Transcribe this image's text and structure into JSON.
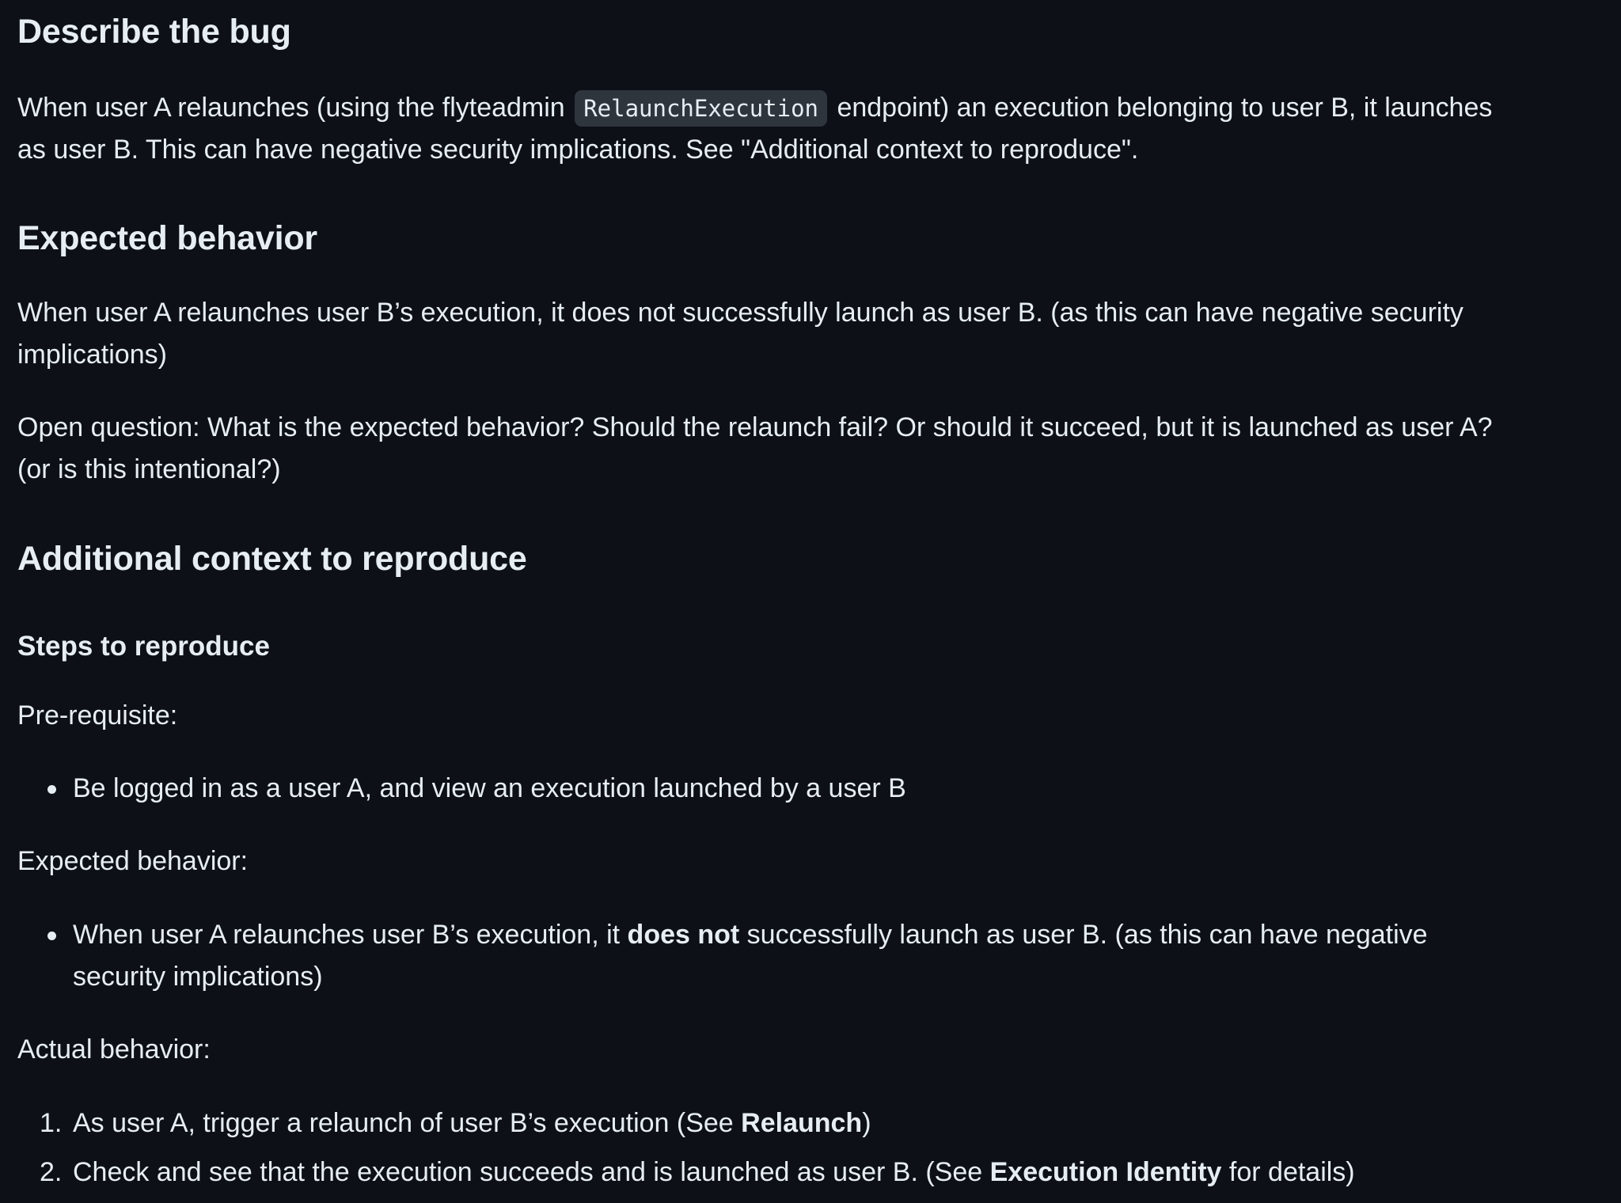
{
  "describe_bug": {
    "heading": "Describe the bug",
    "p1_a": "When user A relaunches (using the flyteadmin",
    "p1_code": "RelaunchExecution",
    "p1_b": "endpoint) an execution belonging to user B, it launches",
    "p1_line2": "as user B. This can have negative security implications. See \"Additional context to reproduce\"."
  },
  "expected_behavior": {
    "heading": "Expected behavior",
    "p1_line1": "When user A relaunches user B’s execution, it does not successfully launch as user B. (as this can have negative security",
    "p1_line2": "implications)",
    "p2_line1": "Open question: What is the expected behavior? Should the relaunch fail? Or should it succeed, but it is launched as user A?",
    "p2_line2": "(or is this intentional?)"
  },
  "additional_context": {
    "heading": "Additional context to reproduce",
    "steps_heading": "Steps to reproduce",
    "prereq_label": "Pre-requisite:",
    "prereq_item": "Be logged in as a user A, and view an execution launched by a user B",
    "expected_label": "Expected behavior:",
    "expected_item_a": "When user A relaunches user B’s execution, it",
    "expected_item_bold": "does not",
    "expected_item_b": "successfully launch as user B. (as this can have negative",
    "expected_item_line2": "security implications)",
    "actual_label": "Actual behavior:",
    "actual_steps": [
      {
        "num": "1.",
        "text_a": "As user A, trigger a relaunch of user B’s execution (See",
        "bold": "Relaunch",
        "text_b": ")"
      },
      {
        "num": "2.",
        "text_a": "Check and see that the execution succeeds and is launched as user B. (See",
        "bold": "Execution Identity",
        "text_b": "for details)"
      }
    ]
  }
}
